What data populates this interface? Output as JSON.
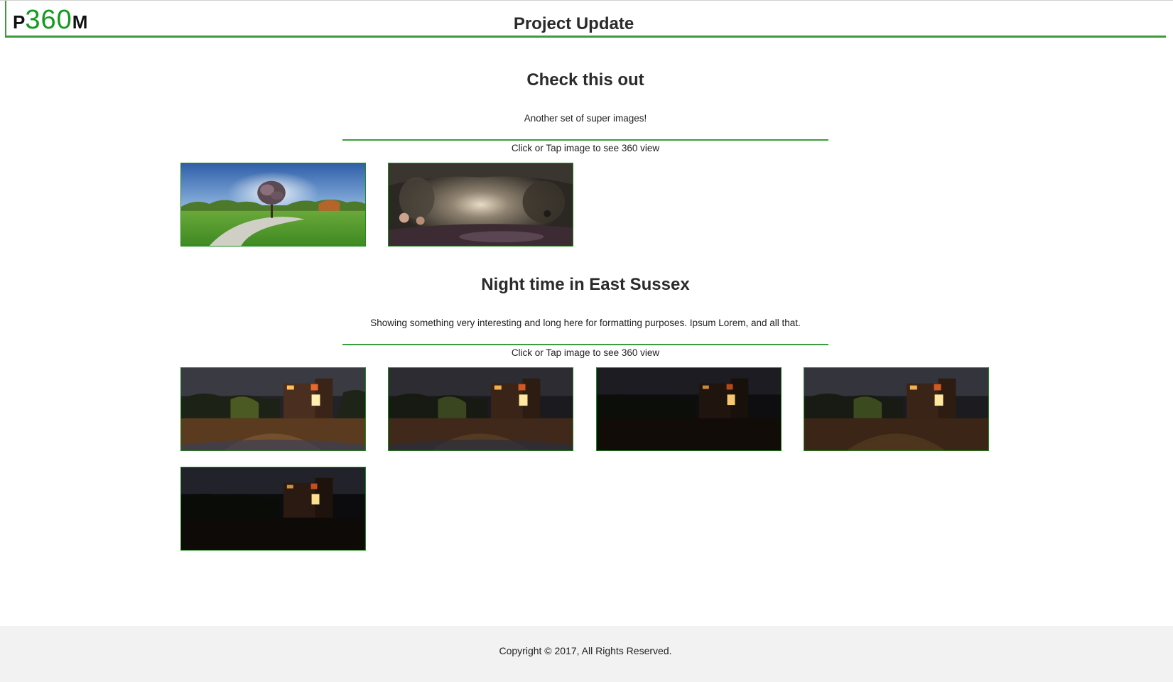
{
  "header": {
    "logo": {
      "prefix": "P",
      "number": "360",
      "suffix": "M"
    },
    "title": "Project Update"
  },
  "sections": [
    {
      "title": "Check this out",
      "description": "Another set of super images!",
      "hint": "Click or Tap image to see 360 view",
      "images": [
        {
          "name": "park-panorama"
        },
        {
          "name": "cave-panorama"
        }
      ]
    },
    {
      "title": "Night time in East Sussex",
      "description": "Showing something very interesting and long here for formatting purposes. Ipsum Lorem, and all that.",
      "hint": "Click or Tap image to see 360 view",
      "images": [
        {
          "name": "night-house-panorama-1"
        },
        {
          "name": "night-house-panorama-2"
        },
        {
          "name": "night-house-panorama-3"
        },
        {
          "name": "night-house-panorama-4"
        },
        {
          "name": "night-house-panorama-5"
        }
      ]
    }
  ],
  "footer": {
    "copyright": "Copyright © 2017, All Rights Reserved."
  },
  "colors": {
    "accent": "#3c9b3c",
    "logo_green": "#119a1b",
    "footer_bg": "#f2f2f2"
  }
}
